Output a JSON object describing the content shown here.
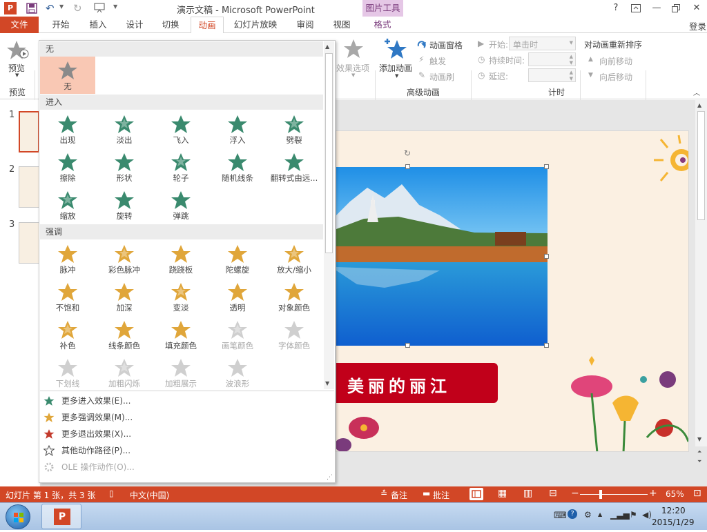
{
  "window": {
    "title": "演示文稿 - Microsoft PowerPoint",
    "context_tab_group": "图片工具",
    "help": "?",
    "signin": "登录"
  },
  "menu": {
    "file": "文件",
    "tabs": [
      "开始",
      "插入",
      "设计",
      "切换",
      "动画",
      "幻灯片放映",
      "审阅",
      "视图",
      "格式"
    ]
  },
  "ribbon": {
    "preview_label": "预览",
    "preview_group": "预览",
    "effect_options": "效果选项",
    "add_animation": "添加动画",
    "animation_pane": "动画窗格",
    "trigger": "触发",
    "animation_painter": "动画刷",
    "advanced_group": "高级动画",
    "start_label": "开始:",
    "start_value": "单击时",
    "duration_label": "持续时间:",
    "delay_label": "延迟:",
    "timing_group": "计时",
    "reorder_title": "对动画重新排序",
    "move_earlier": "向前移动",
    "move_later": "向后移动"
  },
  "thumbnails": [
    "1",
    "2",
    "3"
  ],
  "gallery": {
    "none_header": "无",
    "none_item": "无",
    "entrance_header": "进入",
    "entrance": [
      "出现",
      "淡出",
      "飞入",
      "浮入",
      "劈裂",
      "擦除",
      "形状",
      "轮子",
      "随机线条",
      "翻转式由远...",
      "缩放",
      "旋转",
      "弹跳"
    ],
    "emphasis_header": "强调",
    "emphasis": [
      "脉冲",
      "彩色脉冲",
      "跷跷板",
      "陀螺旋",
      "放大/缩小",
      "不饱和",
      "加深",
      "变淡",
      "透明",
      "对象颜色",
      "补色",
      "线条颜色",
      "填充颜色",
      "画笔颜色",
      "字体颜色",
      "下划线",
      "加粗闪烁",
      "加粗展示",
      "波浪形"
    ],
    "emphasis_disabled": [
      "画笔颜色",
      "字体颜色",
      "下划线",
      "加粗闪烁",
      "加粗展示",
      "波浪形"
    ],
    "more": [
      {
        "label": "更多进入效果(E)...",
        "icon": "green-star-icon"
      },
      {
        "label": "更多强调效果(M)...",
        "icon": "gold-star-icon"
      },
      {
        "label": "更多退出效果(X)...",
        "icon": "red-star-icon"
      },
      {
        "label": "其他动作路径(P)...",
        "icon": "outline-star-icon"
      },
      {
        "label": "OLE 操作动作(O)...",
        "icon": "gear-icon"
      }
    ]
  },
  "slide": {
    "banner_text": "美丽的丽江"
  },
  "status": {
    "slide_info": "幻灯片 第 1 张，共 3 张",
    "language": "中文(中国)",
    "notes": "备注",
    "comments": "批注",
    "zoom": "65%"
  },
  "taskbar": {
    "time": "12:20",
    "date": "2015/1/29"
  },
  "colors": {
    "accent": "#d24726",
    "context_tab": "#e5c7e6",
    "entrance_star": "#3a8a6e",
    "emphasis_star": "#e0a63a",
    "exit_star": "#c33a2c",
    "banner": "#c1001a"
  }
}
